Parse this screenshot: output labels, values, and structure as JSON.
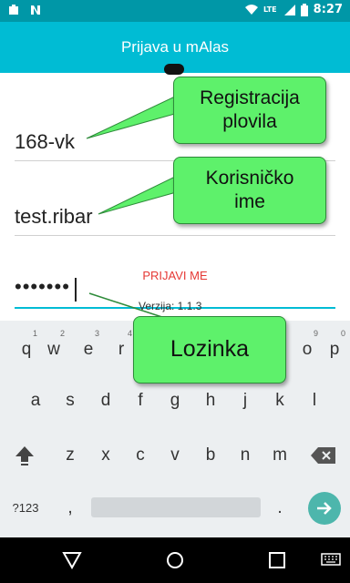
{
  "status_bar": {
    "lte": "LTE",
    "time": "8:27"
  },
  "app_bar": {
    "title": "Prijava u mAlas"
  },
  "form": {
    "vessel_registration": "168-vk",
    "username": "test.ribar",
    "password_masked": "•••••••",
    "login_button": "PRIJAVI ME",
    "version": "Verzija: 1.1.3"
  },
  "callouts": {
    "registration": [
      "Registracija",
      "plovila"
    ],
    "username": [
      "Korisničko",
      "ime"
    ],
    "password": "Lozinka"
  },
  "keyboard": {
    "row1": [
      {
        "key": "q",
        "hint": "1"
      },
      {
        "key": "w",
        "hint": "2"
      },
      {
        "key": "e",
        "hint": "3"
      },
      {
        "key": "r",
        "hint": "4"
      },
      {
        "key": "o",
        "hint": "9"
      },
      {
        "key": "p",
        "hint": "0"
      }
    ],
    "row2": [
      "a",
      "s",
      "d",
      "f",
      "g",
      "h",
      "j",
      "k",
      "l"
    ],
    "row3": [
      "z",
      "x",
      "c",
      "v",
      "b",
      "n",
      "m"
    ],
    "symbols": "?123",
    "comma": ",",
    "period": "."
  },
  "colors": {
    "primary": "#00bcd4",
    "primary_dark": "#0097a7",
    "accent": "#e53935",
    "callout": "#5ef16b",
    "enter": "#4db6ac"
  }
}
